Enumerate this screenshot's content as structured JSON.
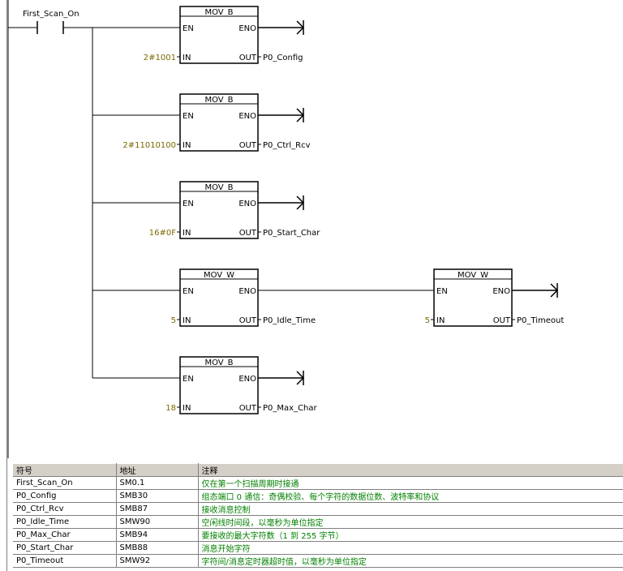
{
  "contact": {
    "name": "First_Scan_On"
  },
  "blocks": [
    {
      "title": "MOV_B",
      "en": "EN",
      "eno": "ENO",
      "in_label": "IN",
      "out_label": "OUT",
      "in_value": "2#1001",
      "out_value": "P0_Config"
    },
    {
      "title": "MOV_B",
      "en": "EN",
      "eno": "ENO",
      "in_label": "IN",
      "out_label": "OUT",
      "in_value": "2#11010100",
      "out_value": "P0_Ctrl_Rcv"
    },
    {
      "title": "MOV_B",
      "en": "EN",
      "eno": "ENO",
      "in_label": "IN",
      "out_label": "OUT",
      "in_value": "16#0F",
      "out_value": "P0_Start_Char"
    },
    {
      "title": "MOV_W",
      "en": "EN",
      "eno": "ENO",
      "in_label": "IN",
      "out_label": "OUT",
      "in_value": "5",
      "out_value": "P0_Idle_Time"
    },
    {
      "title": "MOV_W",
      "en": "EN",
      "eno": "ENO",
      "in_label": "IN",
      "out_label": "OUT",
      "in_value": "5",
      "out_value": "P0_Timeout"
    },
    {
      "title": "MOV_B",
      "en": "EN",
      "eno": "ENO",
      "in_label": "IN",
      "out_label": "OUT",
      "in_value": "18",
      "out_value": "P0_Max_Char"
    }
  ],
  "symbol_table": {
    "headers": {
      "symbol": "符号",
      "address": "地址",
      "comment": "注释"
    },
    "rows": [
      {
        "symbol": "First_Scan_On",
        "address": "SM0.1",
        "comment": "仅在第一个扫描周期时接通"
      },
      {
        "symbol": "P0_Config",
        "address": "SMB30",
        "comment": "组态端口 0 通信：奇偶校验、每个字符的数据位数、波特率和协议"
      },
      {
        "symbol": "P0_Ctrl_Rcv",
        "address": "SMB87",
        "comment": "接收消息控制"
      },
      {
        "symbol": "P0_Idle_Time",
        "address": "SMW90",
        "comment": "空闲线时间段，以毫秒为单位指定"
      },
      {
        "symbol": "P0_Max_Char",
        "address": "SMB94",
        "comment": "要接收的最大字符数（1 到 255 字节）"
      },
      {
        "symbol": "P0_Start_Char",
        "address": "SMB88",
        "comment": "消息开始字符"
      },
      {
        "symbol": "P0_Timeout",
        "address": "SMW92",
        "comment": "字符间/消息定时器超时值，以毫秒为单位指定"
      }
    ]
  },
  "colors": {
    "value_text": "#7a6a00",
    "comment_text": "#008000",
    "header_bg": "#d4d0c8"
  }
}
